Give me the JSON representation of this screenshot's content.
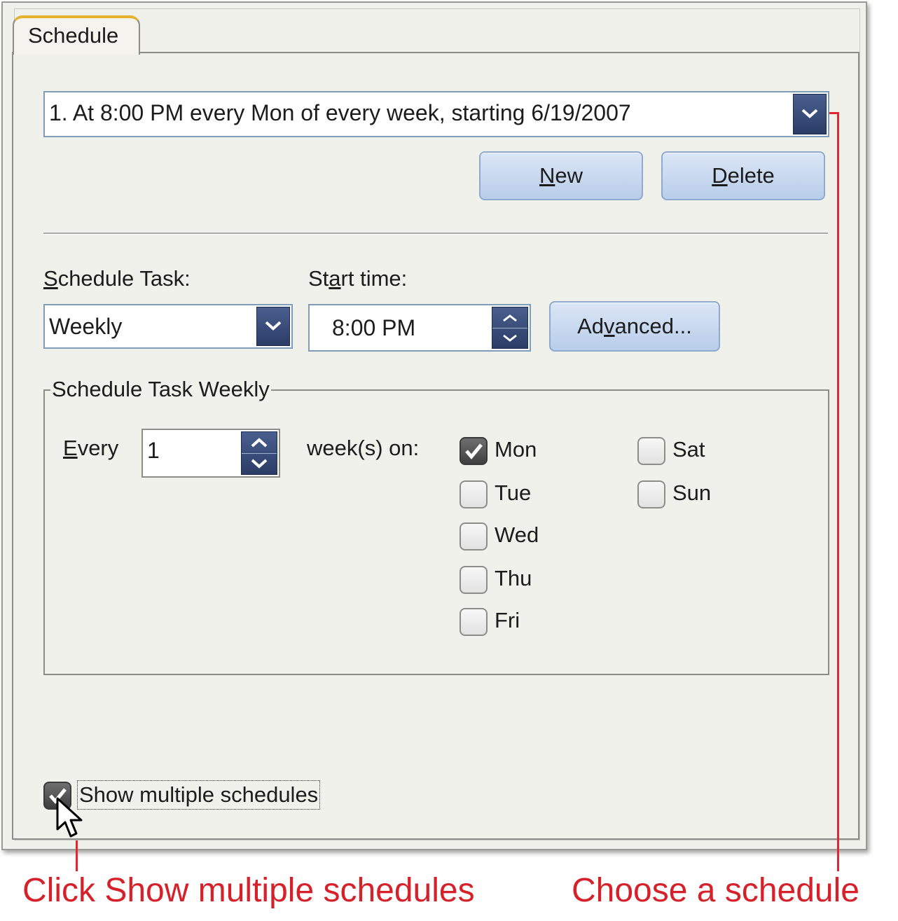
{
  "tab": {
    "label": "Schedule"
  },
  "schedule_combo": {
    "value": "1. At 8:00 PM every Mon of every week, starting 6/19/2007"
  },
  "buttons": {
    "new_prefix": "",
    "new_u": "N",
    "new_rest": "ew",
    "delete_u": "D",
    "delete_rest": "elete",
    "advanced_pre": "Ad",
    "advanced_u": "v",
    "advanced_rest": "anced..."
  },
  "schedule_task": {
    "label_u": "S",
    "label_rest": "chedule Task:",
    "value": "Weekly"
  },
  "start_time": {
    "label_pre": "St",
    "label_u": "a",
    "label_rest": "rt time:",
    "value": "8:00 PM"
  },
  "weekly_group": {
    "title": "Schedule Task Weekly",
    "every_u": "E",
    "every_rest": "very",
    "every_value": "1",
    "weeks_on_label": "week(s) on:",
    "days": [
      {
        "label": "Mon",
        "checked": true
      },
      {
        "label": "Tue",
        "checked": false
      },
      {
        "label": "Wed",
        "checked": false
      },
      {
        "label": "Thu",
        "checked": false
      },
      {
        "label": "Fri",
        "checked": false
      },
      {
        "label": "Sat",
        "checked": false
      },
      {
        "label": "Sun",
        "checked": false
      }
    ]
  },
  "show_multiple": {
    "label": "Show multiple schedules",
    "checked": true
  },
  "annotations": {
    "left": "Click Show multiple schedules",
    "right": "Choose a schedule",
    "color": "#d7212a"
  },
  "colors": {
    "tab_accent": "#e3b22e",
    "button_blue": "#b8cde9",
    "dropdown_navy": "#2b3c66"
  }
}
